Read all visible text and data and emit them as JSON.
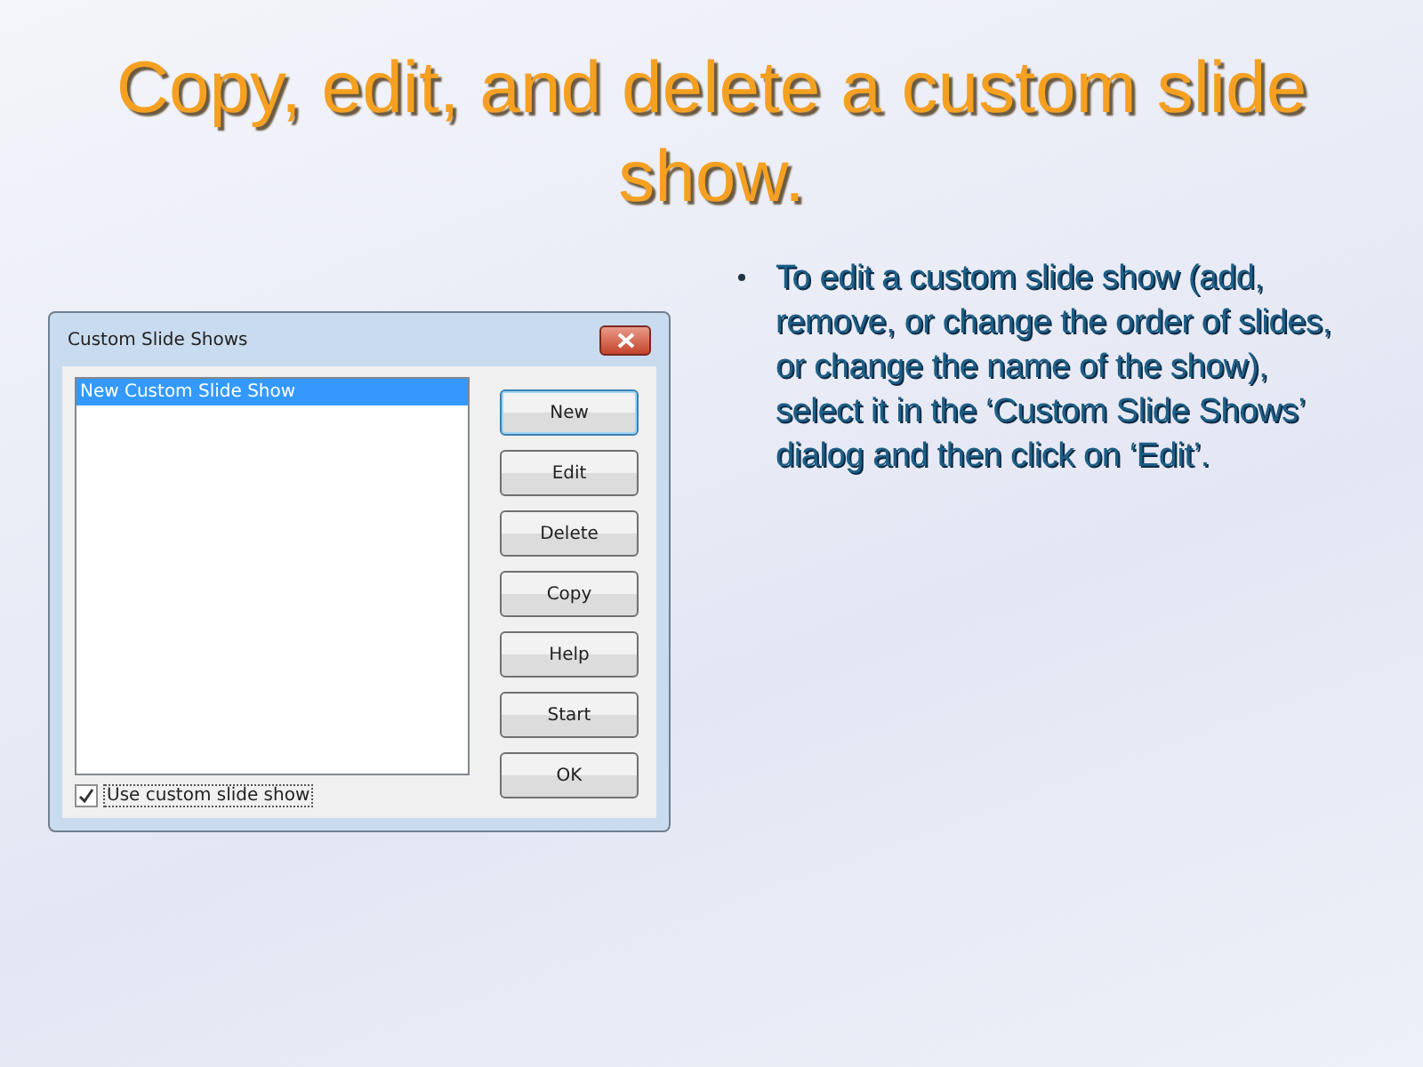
{
  "slide": {
    "title": "Copy, edit, and delete a custom slide show.",
    "bullets": [
      {
        "text": "To edit a custom slide show (add, remove, or change the order of slides, or change the name of the show), select it in the ‘Custom Slide Shows’ dialog and then click on ‘Edit’."
      }
    ]
  },
  "dialog": {
    "title": "Custom Slide Shows",
    "list_items": [
      {
        "label": "New Custom Slide Show",
        "selected": true
      }
    ],
    "buttons": [
      {
        "label": "New",
        "default": true
      },
      {
        "label": "Edit",
        "default": false
      },
      {
        "label": "Delete",
        "default": false
      },
      {
        "label": "Copy",
        "default": false
      },
      {
        "label": "Help",
        "default": false
      },
      {
        "label": "Start",
        "default": false
      },
      {
        "label": "OK",
        "default": false
      }
    ],
    "checkbox": {
      "label": "Use custom slide show",
      "checked": true
    }
  }
}
